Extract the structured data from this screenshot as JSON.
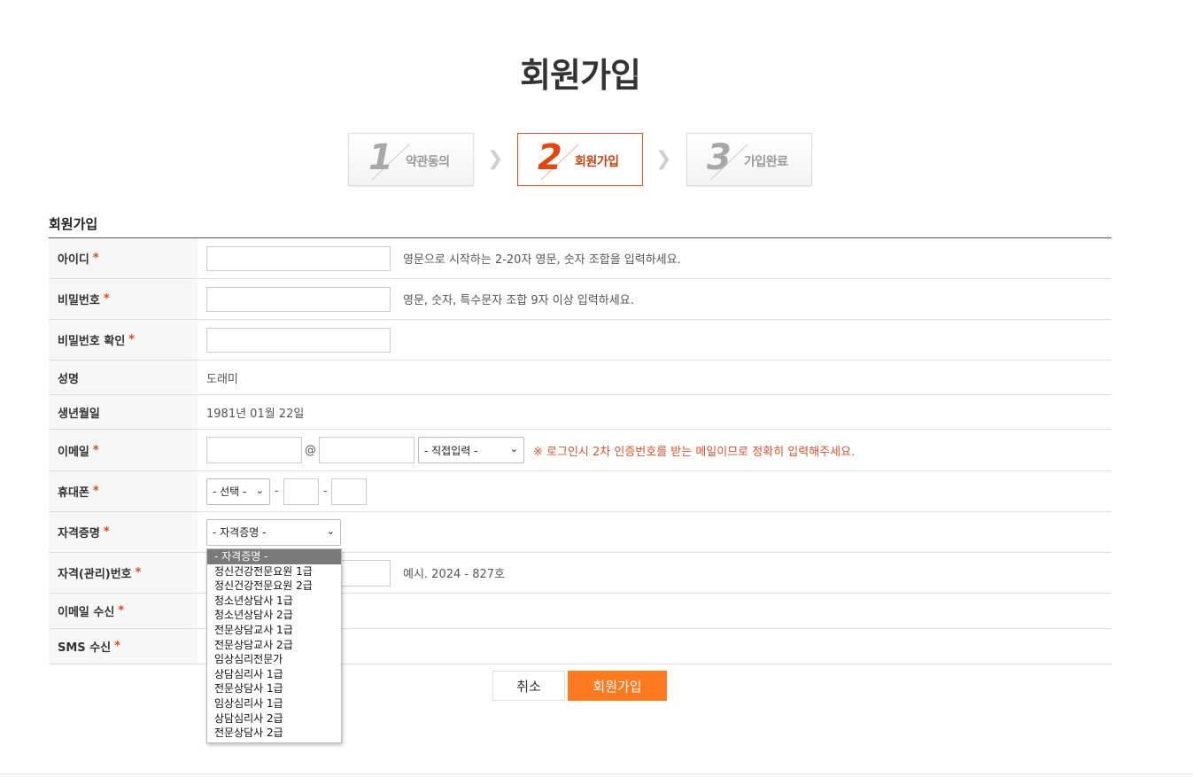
{
  "page_title": "회원가입",
  "steps": [
    {
      "num": "1",
      "label": "약관동의",
      "active": false
    },
    {
      "num": "2",
      "label": "회원가입",
      "active": true
    },
    {
      "num": "3",
      "label": "가입완료",
      "active": false
    }
  ],
  "arrow_glyph": "❯",
  "section_title": "회원가입",
  "required_mark": "*",
  "form": {
    "id": {
      "label": "아이디",
      "hint": "영문으로 시작하는 2-20자 영문, 숫자 조합을 입력하세요."
    },
    "password": {
      "label": "비밀번호",
      "hint": "영문, 숫자, 특수문자 조합 9자 이상 입력하세요."
    },
    "password_confirm": {
      "label": "비밀번호 확인"
    },
    "name": {
      "label": "성명",
      "value": "도래미"
    },
    "birth": {
      "label": "생년월일",
      "value": "1981년 01월 22일"
    },
    "email": {
      "label": "이메일",
      "at": "@",
      "domain_select": "- 직접입력 -",
      "warning": "※ 로그인시 2차 인증번호를 받는 메일이므로 정확히 입력해주세요."
    },
    "phone": {
      "label": "휴대폰",
      "prefix_select": "- 선택 -",
      "dash": "-"
    },
    "cert": {
      "label": "자격증명",
      "select": "- 자격증명 -"
    },
    "cert_number": {
      "label": "자격(관리)번호",
      "hint": "예시. 2024 - 827호"
    },
    "email_receive": {
      "label": "이메일 수신"
    },
    "sms_receive": {
      "label": "SMS 수신"
    }
  },
  "cert_options": [
    "- 자격증명 -",
    "정신건강전문요원 1급",
    "정신건강전문요원 2급",
    "청소년상담사 1급",
    "청소년상담사 2급",
    "전문상담교사 1급",
    "전문상담교사 2급",
    "임상심리전문가",
    "상담심리사 1급",
    "전문상담사 1급",
    "임상심리사 1급",
    "상담심리사 2급",
    "전문상담사 2급"
  ],
  "buttons": {
    "cancel": "취소",
    "join": "회원가입"
  },
  "colors": {
    "accent": "#ff7a1f",
    "active_step": "#e0480f",
    "warning": "#d9532c"
  }
}
